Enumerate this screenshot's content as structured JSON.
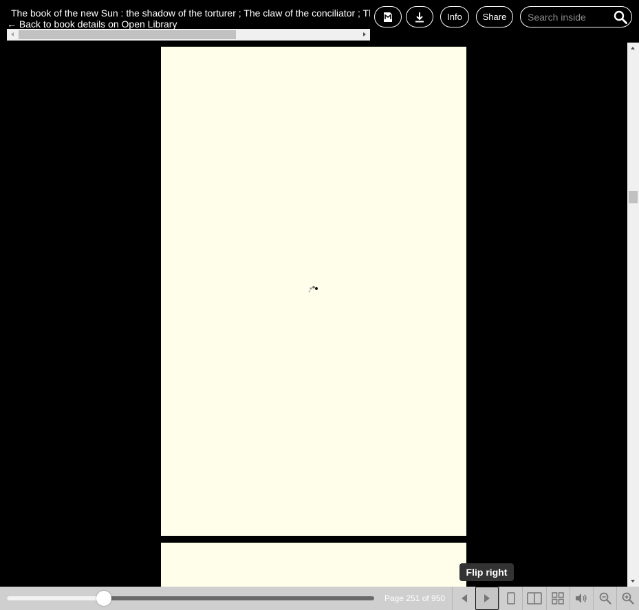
{
  "header": {
    "title": "The book of the new Sun : the shadow of the torturer ; The claw of the conciliator ; The sword of the lictor ; The citadel of the autarch",
    "back_link": "← Back to book details on Open Library",
    "buttons": {
      "page_icon": "bookmark-page-icon",
      "download_icon": "download-icon",
      "info_label": "Info",
      "share_label": "Share"
    },
    "search": {
      "placeholder": "Search inside",
      "value": "",
      "icon": "search-icon"
    }
  },
  "reader": {
    "page_color": "#fefeeb",
    "background": "#000000",
    "loading_icon": "loading-spinner-icon"
  },
  "tooltip": {
    "text": "Flip right"
  },
  "toolbar": {
    "page_label": "Page 251 of 950",
    "current_page": 251,
    "total_pages": 950,
    "slider_fraction": 0.2642,
    "buttons": [
      "flip-left-icon",
      "flip-right-icon",
      "one-page-view-icon",
      "two-page-view-icon",
      "thumbnail-view-icon",
      "read-aloud-icon",
      "zoom-out-icon",
      "zoom-in-icon"
    ]
  }
}
